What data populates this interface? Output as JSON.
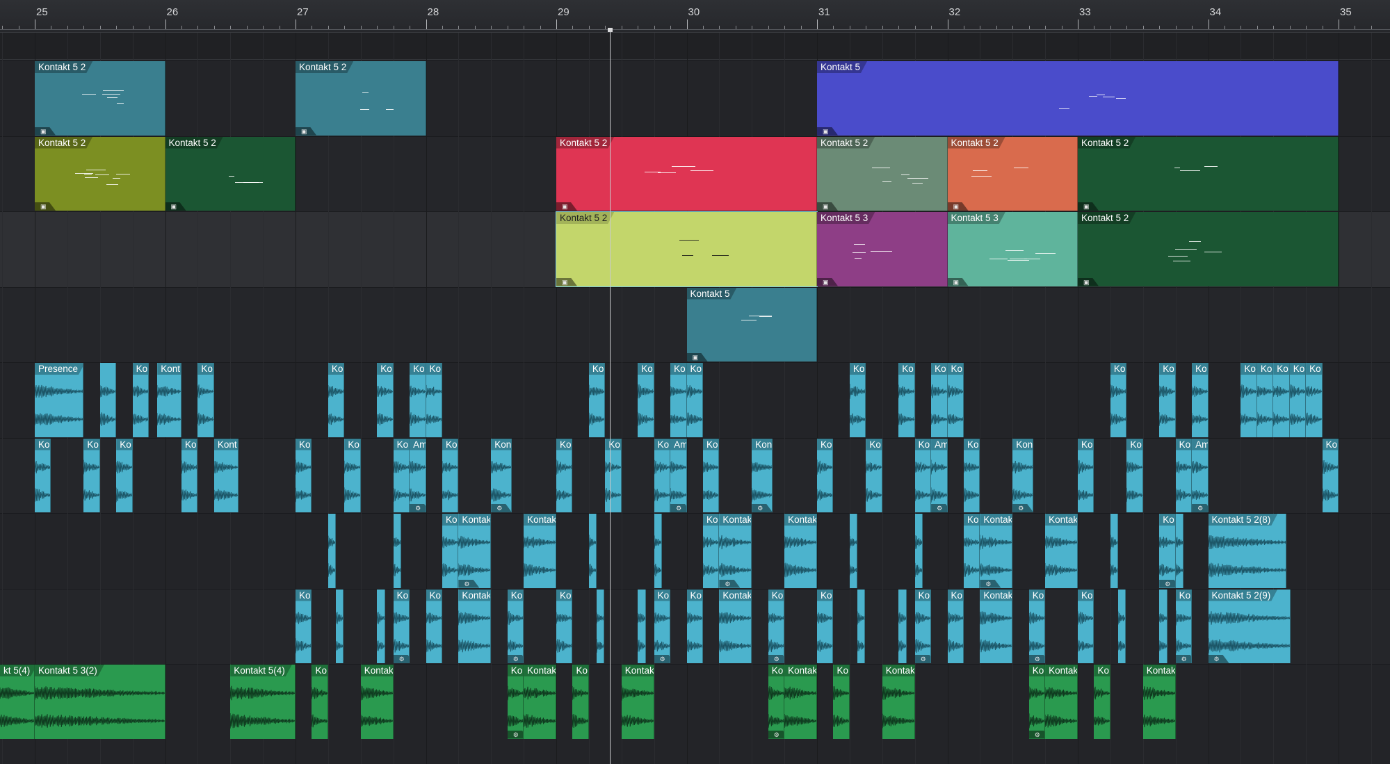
{
  "ruler": {
    "bars": [
      "25",
      "26",
      "27",
      "28",
      "29",
      "30",
      "31",
      "32",
      "33",
      "34",
      "35"
    ]
  },
  "colors": {
    "background": "#232428",
    "teal": "#3a7f8f",
    "olive": "#7c8f22",
    "dark_green": "#1b5633",
    "red": "#df3553",
    "grey_green": "#6b8b76",
    "orange": "#d96b4d",
    "lime": "#c3d66b",
    "purple": "#8e3e86",
    "mint": "#5fb49c",
    "blue_violet": "#4a4ccb",
    "audio_cyan": "#4cb3cd",
    "audio_green": "#2a9a4f",
    "playhead": "#c9cacc"
  },
  "instrument_events": [
    {
      "label": "Kontakt 5 2",
      "lane": 0,
      "start": 25.0,
      "end": 26.0,
      "color": "teal",
      "badge": "lock-icon"
    },
    {
      "label": "Kontakt 5 2",
      "lane": 0,
      "start": 27.0,
      "end": 28.0,
      "color": "teal",
      "badge": "lock-icon"
    },
    {
      "label": "Kontakt 5",
      "lane": 0,
      "start": 31.0,
      "end": 35.0,
      "color": "blue_violet",
      "badge": "lock-icon"
    },
    {
      "label": "Kontakt 5 2",
      "lane": 1,
      "start": 25.0,
      "end": 26.0,
      "color": "olive",
      "badge": "lock-icon"
    },
    {
      "label": "Kontakt 5 2",
      "lane": 1,
      "start": 26.0,
      "end": 27.0,
      "color": "dark_green",
      "badge": "lock-icon"
    },
    {
      "label": "Kontakt 5 2",
      "lane": 1,
      "start": 29.0,
      "end": 31.0,
      "color": "red",
      "badge": "lock-icon"
    },
    {
      "label": "Kontakt 5 2",
      "lane": 1,
      "start": 31.0,
      "end": 32.0,
      "color": "grey_green",
      "badge": "lock-icon"
    },
    {
      "label": "Kontakt 5 2",
      "lane": 1,
      "start": 32.0,
      "end": 33.0,
      "color": "orange",
      "badge": "lock-icon"
    },
    {
      "label": "Kontakt 5 2",
      "lane": 1,
      "start": 33.0,
      "end": 35.0,
      "color": "dark_green",
      "badge": "lock-icon"
    },
    {
      "label": "Kontakt 5 2",
      "lane": 2,
      "start": 29.0,
      "end": 31.0,
      "color": "lime",
      "badge": "lock-icon",
      "light": true
    },
    {
      "label": "Kontakt 5 3",
      "lane": 2,
      "start": 31.0,
      "end": 32.0,
      "color": "purple",
      "badge": "lock-icon"
    },
    {
      "label": "Kontakt 5 3",
      "lane": 2,
      "start": 32.0,
      "end": 33.0,
      "color": "mint",
      "badge": "lock-icon"
    },
    {
      "label": "Kontakt 5 2",
      "lane": 2,
      "start": 33.0,
      "end": 35.0,
      "color": "dark_green",
      "badge": "lock-icon"
    },
    {
      "label": "Kontakt 5",
      "lane": 3,
      "start": 30.0,
      "end": 31.0,
      "color": "teal",
      "badge": "lock-icon"
    }
  ],
  "audio_events": [
    {
      "label": "Presence",
      "lane": 4,
      "start": 25.0,
      "end": 25.375,
      "color": "audio_cyan"
    },
    {
      "label": "",
      "lane": 4,
      "start": 25.5,
      "end": 25.625,
      "color": "audio_cyan"
    },
    {
      "label": "Ko",
      "lane": 4,
      "start": 25.75,
      "end": 25.875,
      "color": "audio_cyan"
    },
    {
      "label": "Kont",
      "lane": 4,
      "start": 25.94,
      "end": 26.125,
      "color": "audio_cyan"
    },
    {
      "label": "Ko",
      "lane": 4,
      "start": 26.25,
      "end": 26.375,
      "color": "audio_cyan"
    },
    {
      "label": "Ko",
      "lane": 4,
      "start": 27.25,
      "end": 27.375,
      "color": "audio_cyan"
    },
    {
      "label": "Ko",
      "lane": 4,
      "start": 27.625,
      "end": 27.75,
      "color": "audio_cyan"
    },
    {
      "label": "Ko",
      "lane": 4,
      "start": 27.875,
      "end": 28.0,
      "color": "audio_cyan"
    },
    {
      "label": "Ko",
      "lane": 4,
      "start": 28.0,
      "end": 28.125,
      "color": "audio_cyan"
    },
    {
      "label": "Ko",
      "lane": 4,
      "start": 29.25,
      "end": 29.375,
      "color": "audio_cyan"
    },
    {
      "label": "Ko",
      "lane": 4,
      "start": 29.625,
      "end": 29.75,
      "color": "audio_cyan"
    },
    {
      "label": "Ko",
      "lane": 4,
      "start": 29.875,
      "end": 30.0,
      "color": "audio_cyan"
    },
    {
      "label": "Ko",
      "lane": 4,
      "start": 30.0,
      "end": 30.125,
      "color": "audio_cyan"
    },
    {
      "label": "Ko",
      "lane": 4,
      "start": 31.25,
      "end": 31.375,
      "color": "audio_cyan"
    },
    {
      "label": "Ko",
      "lane": 4,
      "start": 31.625,
      "end": 31.75,
      "color": "audio_cyan"
    },
    {
      "label": "Ko",
      "lane": 4,
      "start": 31.875,
      "end": 32.0,
      "color": "audio_cyan"
    },
    {
      "label": "Ko",
      "lane": 4,
      "start": 32.0,
      "end": 32.125,
      "color": "audio_cyan"
    },
    {
      "label": "Ko",
      "lane": 4,
      "start": 33.25,
      "end": 33.375,
      "color": "audio_cyan"
    },
    {
      "label": "Ko",
      "lane": 4,
      "start": 33.625,
      "end": 33.75,
      "color": "audio_cyan"
    },
    {
      "label": "Ko",
      "lane": 4,
      "start": 33.875,
      "end": 34.0,
      "color": "audio_cyan"
    },
    {
      "label": "Ko",
      "lane": 4,
      "start": 34.25,
      "end": 34.375,
      "color": "audio_cyan"
    },
    {
      "label": "Ko",
      "lane": 4,
      "start": 34.375,
      "end": 34.5,
      "color": "audio_cyan"
    },
    {
      "label": "Ko",
      "lane": 4,
      "start": 34.5,
      "end": 34.625,
      "color": "audio_cyan"
    },
    {
      "label": "Ko",
      "lane": 4,
      "start": 34.625,
      "end": 34.75,
      "color": "audio_cyan"
    },
    {
      "label": "Ko",
      "lane": 4,
      "start": 34.75,
      "end": 34.875,
      "color": "audio_cyan"
    },
    {
      "label": "Ko",
      "lane": 5,
      "start": 25.0,
      "end": 25.125,
      "color": "audio_cyan"
    },
    {
      "label": "Ko",
      "lane": 5,
      "start": 25.375,
      "end": 25.5,
      "color": "audio_cyan"
    },
    {
      "label": "Ko",
      "lane": 5,
      "start": 25.625,
      "end": 25.75,
      "color": "audio_cyan"
    },
    {
      "label": "Ko",
      "lane": 5,
      "start": 26.125,
      "end": 26.25,
      "color": "audio_cyan"
    },
    {
      "label": "Kont",
      "lane": 5,
      "start": 26.375,
      "end": 26.56,
      "color": "audio_cyan"
    },
    {
      "label": "Ko",
      "lane": 5,
      "start": 27.0,
      "end": 27.125,
      "color": "audio_cyan"
    },
    {
      "label": "Ko",
      "lane": 5,
      "start": 27.375,
      "end": 27.5,
      "color": "audio_cyan"
    },
    {
      "label": "Ko",
      "lane": 5,
      "start": 27.75,
      "end": 27.875,
      "color": "audio_cyan"
    },
    {
      "label": "Am",
      "lane": 5,
      "start": 27.875,
      "end": 28.0,
      "color": "audio_cyan",
      "badge": "gear-icon"
    },
    {
      "label": "Ko",
      "lane": 5,
      "start": 28.125,
      "end": 28.25,
      "color": "audio_cyan"
    },
    {
      "label": "Kon",
      "lane": 5,
      "start": 28.5,
      "end": 28.66,
      "color": "audio_cyan",
      "badge": "gear-icon"
    },
    {
      "label": "Ko",
      "lane": 5,
      "start": 29.0,
      "end": 29.125,
      "color": "audio_cyan"
    },
    {
      "label": "Ko",
      "lane": 5,
      "start": 29.375,
      "end": 29.5,
      "color": "audio_cyan"
    },
    {
      "label": "Ko",
      "lane": 5,
      "start": 29.75,
      "end": 29.875,
      "color": "audio_cyan"
    },
    {
      "label": "Am",
      "lane": 5,
      "start": 29.875,
      "end": 30.0,
      "color": "audio_cyan",
      "badge": "gear-icon"
    },
    {
      "label": "Ko",
      "lane": 5,
      "start": 30.125,
      "end": 30.25,
      "color": "audio_cyan"
    },
    {
      "label": "Kon",
      "lane": 5,
      "start": 30.5,
      "end": 30.66,
      "color": "audio_cyan",
      "badge": "gear-icon"
    },
    {
      "label": "Ko",
      "lane": 5,
      "start": 31.0,
      "end": 31.125,
      "color": "audio_cyan"
    },
    {
      "label": "Ko",
      "lane": 5,
      "start": 31.375,
      "end": 31.5,
      "color": "audio_cyan"
    },
    {
      "label": "Ko",
      "lane": 5,
      "start": 31.75,
      "end": 31.875,
      "color": "audio_cyan"
    },
    {
      "label": "Am",
      "lane": 5,
      "start": 31.875,
      "end": 32.0,
      "color": "audio_cyan",
      "badge": "gear-icon"
    },
    {
      "label": "Ko",
      "lane": 5,
      "start": 32.125,
      "end": 32.25,
      "color": "audio_cyan"
    },
    {
      "label": "Kon",
      "lane": 5,
      "start": 32.5,
      "end": 32.66,
      "color": "audio_cyan",
      "badge": "gear-icon"
    },
    {
      "label": "Ko",
      "lane": 5,
      "start": 33.0,
      "end": 33.125,
      "color": "audio_cyan"
    },
    {
      "label": "Ko",
      "lane": 5,
      "start": 33.375,
      "end": 33.5,
      "color": "audio_cyan"
    },
    {
      "label": "Ko",
      "lane": 5,
      "start": 33.75,
      "end": 33.875,
      "color": "audio_cyan"
    },
    {
      "label": "Am",
      "lane": 5,
      "start": 33.875,
      "end": 34.0,
      "color": "audio_cyan",
      "badge": "gear-icon"
    },
    {
      "label": "Ko",
      "lane": 5,
      "start": 34.875,
      "end": 35.0,
      "color": "audio_cyan"
    },
    {
      "label": "",
      "lane": 6,
      "start": 27.25,
      "end": 27.31,
      "color": "audio_cyan"
    },
    {
      "label": "",
      "lane": 6,
      "start": 27.75,
      "end": 27.81,
      "color": "audio_cyan"
    },
    {
      "label": "Ko",
      "lane": 6,
      "start": 28.125,
      "end": 28.25,
      "color": "audio_cyan"
    },
    {
      "label": "Kontakt",
      "lane": 6,
      "start": 28.25,
      "end": 28.5,
      "color": "audio_cyan",
      "badge": "gear-icon"
    },
    {
      "label": "Kontakt",
      "lane": 6,
      "start": 28.75,
      "end": 29.0,
      "color": "audio_cyan"
    },
    {
      "label": "",
      "lane": 6,
      "start": 29.25,
      "end": 29.31,
      "color": "audio_cyan"
    },
    {
      "label": "",
      "lane": 6,
      "start": 29.75,
      "end": 29.81,
      "color": "audio_cyan"
    },
    {
      "label": "Ko",
      "lane": 6,
      "start": 30.125,
      "end": 30.25,
      "color": "audio_cyan"
    },
    {
      "label": "Kontakt",
      "lane": 6,
      "start": 30.25,
      "end": 30.5,
      "color": "audio_cyan",
      "badge": "gear-icon"
    },
    {
      "label": "Kontakt",
      "lane": 6,
      "start": 30.75,
      "end": 31.0,
      "color": "audio_cyan"
    },
    {
      "label": "",
      "lane": 6,
      "start": 31.25,
      "end": 31.31,
      "color": "audio_cyan"
    },
    {
      "label": "",
      "lane": 6,
      "start": 31.75,
      "end": 31.81,
      "color": "audio_cyan"
    },
    {
      "label": "Ko",
      "lane": 6,
      "start": 32.125,
      "end": 32.25,
      "color": "audio_cyan"
    },
    {
      "label": "Kontakt",
      "lane": 6,
      "start": 32.25,
      "end": 32.5,
      "color": "audio_cyan",
      "badge": "gear-icon"
    },
    {
      "label": "Kontakt",
      "lane": 6,
      "start": 32.75,
      "end": 33.0,
      "color": "audio_cyan"
    },
    {
      "label": "",
      "lane": 6,
      "start": 33.25,
      "end": 33.31,
      "color": "audio_cyan"
    },
    {
      "label": "Ko",
      "lane": 6,
      "start": 33.625,
      "end": 33.75,
      "color": "audio_cyan",
      "badge": "gear-icon"
    },
    {
      "label": "",
      "lane": 6,
      "start": 33.75,
      "end": 33.81,
      "color": "audio_cyan"
    },
    {
      "label": "Kontakt 5 2(8)",
      "lane": 6,
      "start": 34.0,
      "end": 34.6,
      "color": "audio_cyan"
    },
    {
      "label": "Ko",
      "lane": 7,
      "start": 27.0,
      "end": 27.125,
      "color": "audio_cyan"
    },
    {
      "label": "",
      "lane": 7,
      "start": 27.31,
      "end": 27.37,
      "color": "audio_cyan"
    },
    {
      "label": "",
      "lane": 7,
      "start": 27.625,
      "end": 27.69,
      "color": "audio_cyan"
    },
    {
      "label": "Ko",
      "lane": 7,
      "start": 27.75,
      "end": 27.875,
      "color": "audio_cyan",
      "badge": "gear-icon"
    },
    {
      "label": "Ko",
      "lane": 7,
      "start": 28.0,
      "end": 28.125,
      "color": "audio_cyan"
    },
    {
      "label": "Kontakt",
      "lane": 7,
      "start": 28.25,
      "end": 28.5,
      "color": "audio_cyan"
    },
    {
      "label": "Ko",
      "lane": 7,
      "start": 28.625,
      "end": 28.75,
      "color": "audio_cyan",
      "badge": "gear-icon"
    },
    {
      "label": "Ko",
      "lane": 7,
      "start": 29.0,
      "end": 29.125,
      "color": "audio_cyan"
    },
    {
      "label": "",
      "lane": 7,
      "start": 29.31,
      "end": 29.37,
      "color": "audio_cyan"
    },
    {
      "label": "",
      "lane": 7,
      "start": 29.625,
      "end": 29.69,
      "color": "audio_cyan"
    },
    {
      "label": "Ko",
      "lane": 7,
      "start": 29.75,
      "end": 29.875,
      "color": "audio_cyan",
      "badge": "gear-icon"
    },
    {
      "label": "Ko",
      "lane": 7,
      "start": 30.0,
      "end": 30.125,
      "color": "audio_cyan"
    },
    {
      "label": "Kontakt",
      "lane": 7,
      "start": 30.25,
      "end": 30.5,
      "color": "audio_cyan"
    },
    {
      "label": "Ko",
      "lane": 7,
      "start": 30.625,
      "end": 30.75,
      "color": "audio_cyan",
      "badge": "gear-icon"
    },
    {
      "label": "Ko",
      "lane": 7,
      "start": 31.0,
      "end": 31.125,
      "color": "audio_cyan"
    },
    {
      "label": "",
      "lane": 7,
      "start": 31.31,
      "end": 31.37,
      "color": "audio_cyan"
    },
    {
      "label": "",
      "lane": 7,
      "start": 31.625,
      "end": 31.69,
      "color": "audio_cyan"
    },
    {
      "label": "Ko",
      "lane": 7,
      "start": 31.75,
      "end": 31.875,
      "color": "audio_cyan",
      "badge": "gear-icon"
    },
    {
      "label": "Ko",
      "lane": 7,
      "start": 32.0,
      "end": 32.125,
      "color": "audio_cyan"
    },
    {
      "label": "Kontakt",
      "lane": 7,
      "start": 32.25,
      "end": 32.5,
      "color": "audio_cyan"
    },
    {
      "label": "Ko",
      "lane": 7,
      "start": 32.625,
      "end": 32.75,
      "color": "audio_cyan",
      "badge": "gear-icon"
    },
    {
      "label": "Ko",
      "lane": 7,
      "start": 33.0,
      "end": 33.125,
      "color": "audio_cyan"
    },
    {
      "label": "",
      "lane": 7,
      "start": 33.31,
      "end": 33.37,
      "color": "audio_cyan"
    },
    {
      "label": "",
      "lane": 7,
      "start": 33.625,
      "end": 33.69,
      "color": "audio_cyan"
    },
    {
      "label": "Ko",
      "lane": 7,
      "start": 33.75,
      "end": 33.875,
      "color": "audio_cyan",
      "badge": "gear-icon"
    },
    {
      "label": "Kontakt 5 2(9)",
      "lane": 7,
      "start": 34.0,
      "end": 34.63,
      "color": "audio_cyan",
      "badge": "gear-icon"
    },
    {
      "label": "kt 5(4)",
      "lane": 8,
      "start": 24.73,
      "end": 25.0,
      "color": "audio_green"
    },
    {
      "label": "Kontakt 5 3(2)",
      "lane": 8,
      "start": 25.0,
      "end": 26.0,
      "color": "audio_green"
    },
    {
      "label": "Kontakt 5(4)",
      "lane": 8,
      "start": 26.5,
      "end": 27.0,
      "color": "audio_green"
    },
    {
      "label": "Ko",
      "lane": 8,
      "start": 27.125,
      "end": 27.25,
      "color": "audio_green"
    },
    {
      "label": "Kontakt",
      "lane": 8,
      "start": 27.5,
      "end": 27.75,
      "color": "audio_green"
    },
    {
      "label": "Ko",
      "lane": 8,
      "start": 28.625,
      "end": 28.75,
      "color": "audio_green",
      "badge": "gear-icon"
    },
    {
      "label": "Kontakt",
      "lane": 8,
      "start": 28.75,
      "end": 29.0,
      "color": "audio_green"
    },
    {
      "label": "Ko",
      "lane": 8,
      "start": 29.125,
      "end": 29.25,
      "color": "audio_green"
    },
    {
      "label": "Kontakt",
      "lane": 8,
      "start": 29.5,
      "end": 29.75,
      "color": "audio_green"
    },
    {
      "label": "Ko",
      "lane": 8,
      "start": 30.625,
      "end": 30.75,
      "color": "audio_green",
      "badge": "gear-icon"
    },
    {
      "label": "Kontakt",
      "lane": 8,
      "start": 30.75,
      "end": 31.0,
      "color": "audio_green"
    },
    {
      "label": "Ko",
      "lane": 8,
      "start": 31.125,
      "end": 31.25,
      "color": "audio_green"
    },
    {
      "label": "Kontakt",
      "lane": 8,
      "start": 31.5,
      "end": 31.75,
      "color": "audio_green"
    },
    {
      "label": "Ko",
      "lane": 8,
      "start": 32.625,
      "end": 32.75,
      "color": "audio_green",
      "badge": "gear-icon"
    },
    {
      "label": "Kontakt",
      "lane": 8,
      "start": 32.75,
      "end": 33.0,
      "color": "audio_green"
    },
    {
      "label": "Ko",
      "lane": 8,
      "start": 33.125,
      "end": 33.25,
      "color": "audio_green"
    },
    {
      "label": "Kontakt",
      "lane": 8,
      "start": 33.5,
      "end": 33.75,
      "color": "audio_green"
    }
  ],
  "playhead": {
    "position_bars": 29.41
  }
}
